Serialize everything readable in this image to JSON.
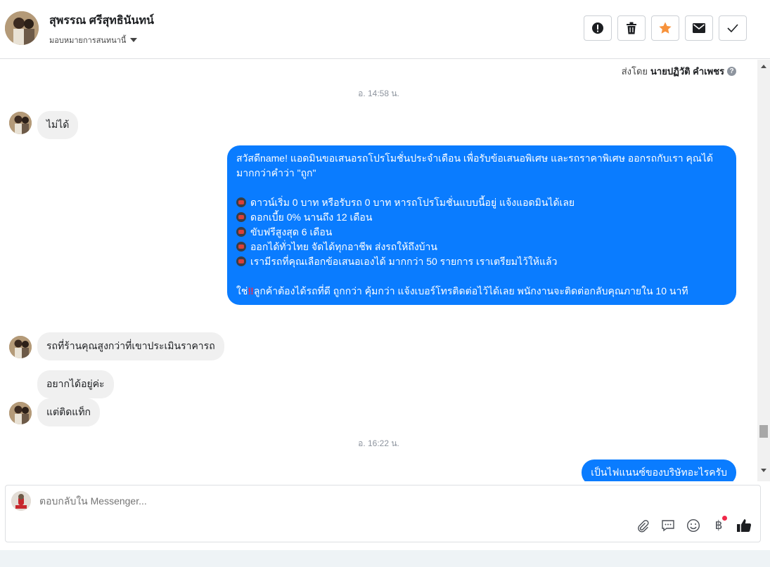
{
  "header": {
    "name": "สุพรรณ ศรีสุทธินันทน์",
    "assign_label": "มอบหมายการสนทนานี้",
    "actions": [
      {
        "icon": "alert-icon"
      },
      {
        "icon": "trash-icon"
      },
      {
        "icon": "star-icon",
        "color": "#f7923b"
      },
      {
        "icon": "envelope-icon"
      },
      {
        "icon": "check-icon"
      }
    ]
  },
  "conversation": {
    "sent_by_label": "ส่งโดย",
    "sent_by_name": "นายปฏิวัติ คำเพชร",
    "timestamp_1": "อ. 14:58 น.",
    "timestamp_2": "อ. 16:22 น.",
    "messages": [
      {
        "from": "customer",
        "text": "ไม่ได้"
      },
      {
        "from": "page",
        "intro": "สวัสดีname! แอดมินขอเสนอรถโปรโมชั่นประจำเดือน เพื่อรับข้อเสนอพิเศษ และรถราคาพิเศษ ออกรถกับเรา คุณได้มากกว่าคำว่า \"ถูก\"",
        "bullets": [
          "ดาวน์เริ่ม 0 บาท หรือรับรถ 0 บาท หารถโปรโมชั่นแบบนี้อยู่ แจ้งแอดมินได้เลย",
          "ดอกเบี้ย 0% นานถึง 12 เดือน",
          "ขับฟรีสูงสุด 6 เดือน",
          "ออกได้ทั่วไทย จัดได้ทุกอาชีพ ส่งรถให้ถึงบ้าน",
          "เรามีรถที่คุณเลือกข้อเสนอเองได้ มากกว่า 50 รายการ เราเตรียมไว้ให้แล้ว"
        ],
        "closing_prefix": "ใช่",
        "closing_mark": "‼",
        "closing": "ลูกค้าต้องได้รถที่ดี ถูกกว่า คุ้มกว่า แจ้งเบอร์โทรติดต่อไว้ได้เลย พนักงานจะติดต่อกลับคุณภายใน 10 นาที"
      },
      {
        "from": "customer",
        "text": "รถที่ร้านคุณสูงกว่าที่เขาประเมินราคารถ"
      },
      {
        "from": "customer",
        "text": "อยากได้อยู่ค่ะ"
      },
      {
        "from": "customer",
        "text": "แต่ติดแท็ก"
      },
      {
        "from": "page",
        "text": "เป็นไฟแนนซ์ของบริษัทอะไรครับ"
      }
    ]
  },
  "composer": {
    "placeholder": "ตอบกลับใน Messenger...",
    "tools": [
      "attach-icon",
      "saved-reply-icon",
      "emoji-icon",
      "baht-icon",
      "like-icon"
    ],
    "baht_symbol": "฿",
    "brand_color": "#0a7cff"
  }
}
